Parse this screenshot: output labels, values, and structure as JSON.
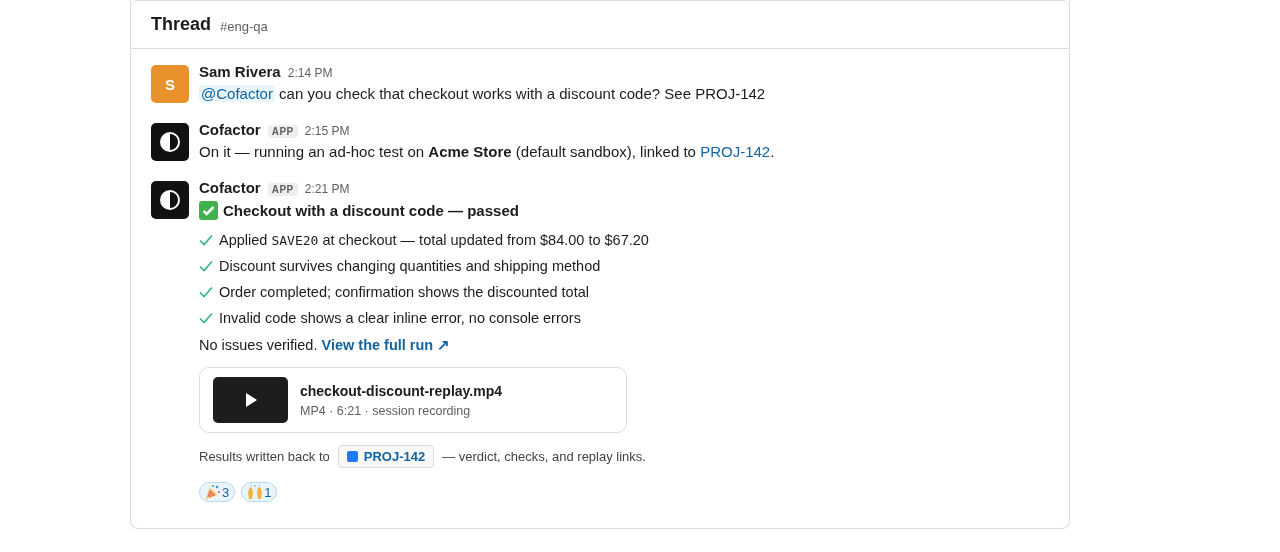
{
  "header": {
    "title": "Thread",
    "channel": "#eng-qa"
  },
  "messages": [
    {
      "author": "Sam Rivera",
      "avatar": {
        "kind": "letter",
        "letter": "S",
        "color": "#e8912d"
      },
      "time": "2:14 PM",
      "text": [
        {
          "kind": "mention",
          "text": "@Cofactor"
        },
        {
          "kind": "plain",
          "text": " can you check that checkout works with a discount code? See PROJ-142"
        }
      ]
    },
    {
      "author": "Cofactor",
      "badge": "APP",
      "avatar": {
        "kind": "logo"
      },
      "time": "2:15 PM",
      "text": [
        {
          "kind": "plain",
          "text": "On it — running an ad-hoc test on "
        },
        {
          "kind": "bold",
          "text": "Acme Store"
        },
        {
          "kind": "plain",
          "text": " (default sandbox), linked to "
        },
        {
          "kind": "link",
          "text": "PROJ-142"
        },
        {
          "kind": "plain",
          "text": "."
        }
      ]
    },
    {
      "author": "Cofactor",
      "badge": "APP",
      "avatar": {
        "kind": "logo"
      },
      "time": "2:21 PM",
      "result": {
        "passed": true,
        "title": "Checkout with a discount code — passed",
        "checks": [
          [
            {
              "kind": "plain",
              "text": "Applied "
            },
            {
              "kind": "code",
              "text": "SAVE20"
            },
            {
              "kind": "plain",
              "text": " at checkout — total updated from $84.00 to $67.20"
            }
          ],
          [
            {
              "kind": "plain",
              "text": "Discount survives changing quantities and shipping method"
            }
          ],
          [
            {
              "kind": "plain",
              "text": "Order completed; confirmation shows the discounted total"
            }
          ],
          [
            {
              "kind": "plain",
              "text": "Invalid code shows a clear inline error, no console errors"
            }
          ]
        ],
        "summary": "No issues verified.",
        "link": "View the full run ↗",
        "attachment": {
          "name": "checkout-discount-replay.mp4",
          "meta": "MP4 · 6:21 · session recording"
        },
        "writeback": {
          "before": "Results written back to",
          "ticket": "PROJ-142",
          "color": "#1d7afc",
          "after": "— verdict, checks, and replay links."
        }
      },
      "reactions": [
        {
          "kind": "party",
          "count": "3"
        },
        {
          "kind": "hands",
          "count": "1"
        }
      ]
    }
  ]
}
